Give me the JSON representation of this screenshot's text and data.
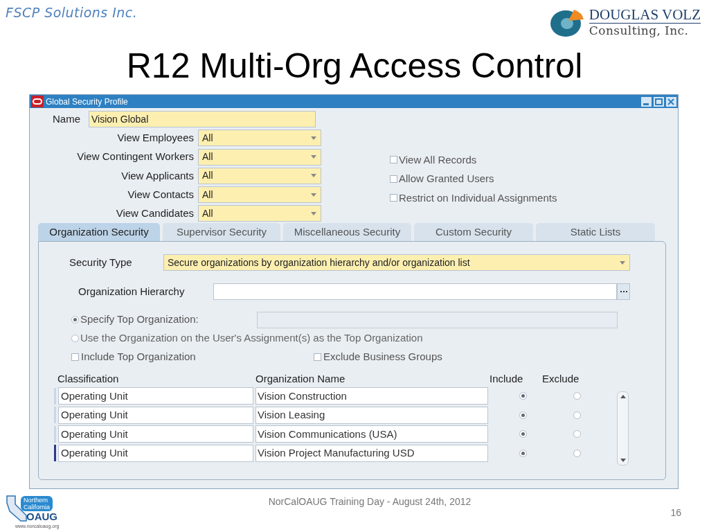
{
  "header": {
    "company": "FSCP Solutions Inc.",
    "logo_line1": "DOUGLAS VOLZ",
    "logo_line2": "Consulting, Inc."
  },
  "slide_title": "R12 Multi-Org Access Control",
  "window": {
    "title": "Global Security Profile"
  },
  "name_field": {
    "label": "Name",
    "value": "Vision Global"
  },
  "view_fields": [
    {
      "label": "View Employees",
      "value": "All"
    },
    {
      "label": "View Contingent Workers",
      "value": "All"
    },
    {
      "label": "View Applicants",
      "value": "All"
    },
    {
      "label": "View Contacts",
      "value": "All"
    },
    {
      "label": "View Candidates",
      "value": "All"
    }
  ],
  "options": [
    {
      "label": "View All Records",
      "checked": false
    },
    {
      "label": "Allow Granted Users",
      "checked": false
    },
    {
      "label": "Restrict on Individual Assignments",
      "checked": false
    }
  ],
  "tabs": [
    {
      "label": "Organization Security",
      "selected": true
    },
    {
      "label": "Supervisor Security",
      "selected": false
    },
    {
      "label": "Miscellaneous Security",
      "selected": false
    },
    {
      "label": "Custom Security",
      "selected": false
    },
    {
      "label": "Static Lists",
      "selected": false
    }
  ],
  "security_type": {
    "label": "Security Type",
    "value": "Secure organizations by organization hierarchy and/or organization list"
  },
  "org_hierarchy": {
    "label": "Organization Hierarchy"
  },
  "top_org_options": [
    {
      "label": "Specify Top Organization:",
      "selected": true
    },
    {
      "label": "Use the Organization on the User's Assignment(s) as the Top Organization",
      "selected": false
    }
  ],
  "include_checks": [
    {
      "label": "Include Top Organization",
      "checked": false
    },
    {
      "label": "Exclude Business Groups",
      "checked": false
    }
  ],
  "table": {
    "columns": [
      "Classification",
      "Organization Name",
      "Include",
      "Exclude"
    ],
    "rows": [
      {
        "classification": "Operating Unit",
        "organization_name": "Vision Construction",
        "include": true,
        "current": false
      },
      {
        "classification": "Operating Unit",
        "organization_name": "Vision Leasing",
        "include": true,
        "current": false
      },
      {
        "classification": "Operating Unit",
        "organization_name": "Vision Communications (USA)",
        "include": true,
        "current": false
      },
      {
        "classification": "Operating Unit",
        "organization_name": "Vision Project Manufacturing USD",
        "include": true,
        "current": true
      }
    ]
  },
  "footer": {
    "event": "NorCalOAUG Training Day - August 24th, 2012",
    "page": "16",
    "logo_line1": "Northern",
    "logo_line2": "California",
    "logo_line3": "OAUG",
    "url": "www.norcaloaug.org"
  }
}
